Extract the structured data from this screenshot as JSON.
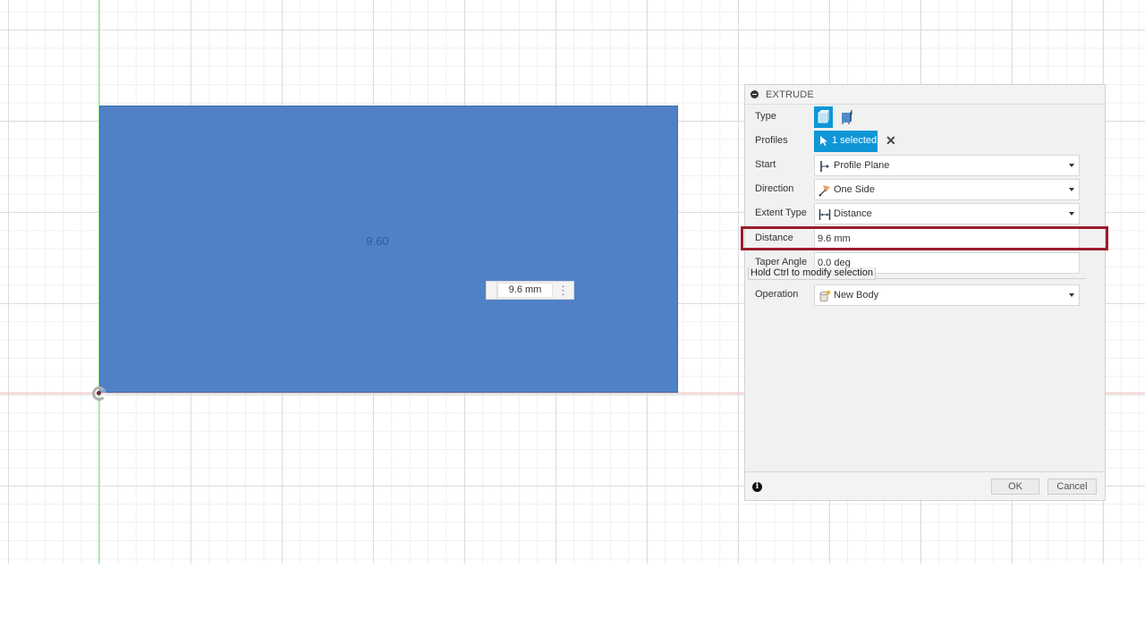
{
  "canvas": {
    "sketch_dimension_label": "9.60",
    "inline_distance_value": "9.6 mm",
    "sketch_fill_color": "#5081c6"
  },
  "panel": {
    "title": "EXTRUDE",
    "rows": {
      "type": {
        "label": "Type",
        "options": [
          "solid-extrude-icon",
          "thin-extrude-icon"
        ],
        "selected": "solid-extrude-icon"
      },
      "profiles": {
        "label": "Profiles",
        "value": "1 selected"
      },
      "start": {
        "label": "Start",
        "value": "Profile Plane",
        "icon": "profile-plane-icon"
      },
      "direction": {
        "label": "Direction",
        "value": "One Side",
        "icon": "one-side-icon"
      },
      "extent_type": {
        "label": "Extent Type",
        "value": "Distance",
        "icon": "distance-icon"
      },
      "distance": {
        "label": "Distance",
        "value": "9.6 mm"
      },
      "taper_angle": {
        "label": "Taper Angle",
        "value": "0.0 deg"
      },
      "operation": {
        "label": "Operation",
        "value": "New Body",
        "icon": "new-body-icon"
      }
    },
    "tooltip": "Hold Ctrl to modify selection",
    "footer": {
      "ok_label": "OK",
      "cancel_label": "Cancel"
    },
    "accent_color": "#0f96d6",
    "highlight_color": "#9b1c2a"
  }
}
